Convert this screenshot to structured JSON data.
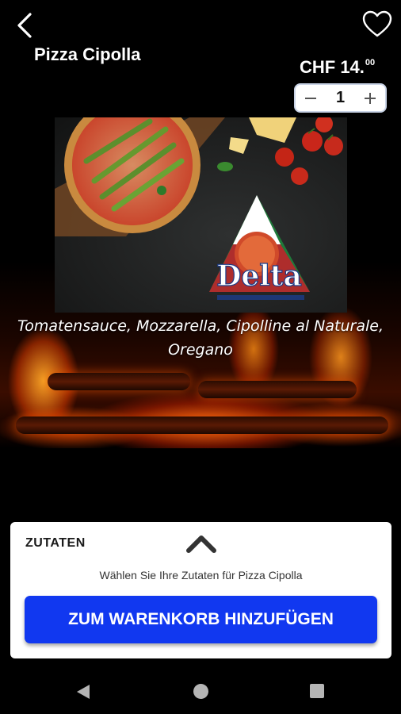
{
  "product": {
    "name": "Pizza Cipolla",
    "price_main": "CHF 14.",
    "price_cents": "00",
    "quantity": "1",
    "description": "Tomatensauce, Mozzarella, Cipolline al Naturale, Oregano",
    "image_logo_text": "Delta"
  },
  "ingredients_panel": {
    "title": "ZUTATEN",
    "hint": "Wählen Sie Ihre Zutaten für Pizza Cipolla",
    "add_to_cart_label": "ZUM WARENKORB HINZUFÜGEN"
  },
  "icons": {
    "back": "chevron-left-icon",
    "favorite": "heart-outline-icon",
    "minus": "minus-icon",
    "plus": "plus-icon",
    "expand": "chevron-up-icon"
  },
  "colors": {
    "accent": "#1138f0",
    "background": "#000000",
    "panel": "#ffffff"
  }
}
